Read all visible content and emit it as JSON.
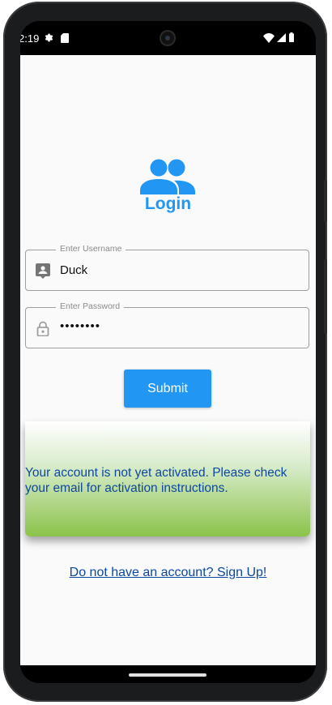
{
  "status_bar": {
    "time": "2:19",
    "left_icons": [
      "gear-icon",
      "sd-card-icon"
    ],
    "right_icons": [
      "wifi-icon",
      "signal-icon",
      "battery-icon"
    ]
  },
  "header": {
    "icon": "people-icon",
    "title": "Login"
  },
  "form": {
    "username": {
      "label": "Enter Username",
      "value": "Duck",
      "icon": "account-box-icon"
    },
    "password": {
      "label": "Enter Password",
      "value": "••••••••",
      "icon": "lock-icon"
    },
    "submit_label": "Submit"
  },
  "alert": {
    "message": "Your account is not yet activated. Please check your email for activation instructions."
  },
  "signup_link": "Do not have an account? Sign Up!",
  "colors": {
    "accent": "#2196f3",
    "link": "#0d47a1",
    "alert_gradient_end": "#8bc34a",
    "background": "#fafafa"
  }
}
